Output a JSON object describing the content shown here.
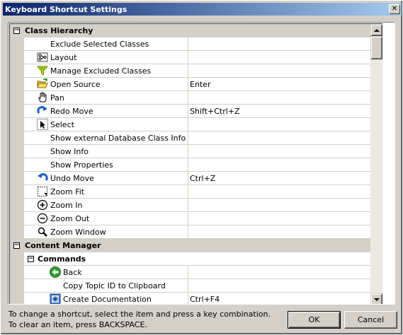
{
  "window": {
    "title": "Keyboard Shortcut Settings",
    "close_glyph": "✕"
  },
  "categories": [
    {
      "label": "Class Hierarchy",
      "expander": "−",
      "items": [
        {
          "label": "Exclude Selected Classes",
          "shortcut": "",
          "icon": ""
        },
        {
          "label": "Layout",
          "shortcut": "",
          "icon": "layout-icon"
        },
        {
          "label": "Manage Excluded Classes",
          "shortcut": "",
          "icon": "filter-icon"
        },
        {
          "label": "Open Source",
          "shortcut": "Enter",
          "icon": "open-folder-icon"
        },
        {
          "label": "Pan",
          "shortcut": "",
          "icon": "hand-icon"
        },
        {
          "label": "Redo Move",
          "shortcut": "Shift+Ctrl+Z",
          "icon": "redo-icon"
        },
        {
          "label": "Select",
          "shortcut": "",
          "icon": "cursor-icon"
        },
        {
          "label": "Show external Database Class Info",
          "shortcut": "",
          "icon": ""
        },
        {
          "label": "Show Info",
          "shortcut": "",
          "icon": ""
        },
        {
          "label": "Show Properties",
          "shortcut": "",
          "icon": ""
        },
        {
          "label": "Undo Move",
          "shortcut": "Ctrl+Z",
          "icon": "undo-icon"
        },
        {
          "label": "Zoom Fit",
          "shortcut": "",
          "icon": "zoom-fit-icon"
        },
        {
          "label": "Zoom In",
          "shortcut": "",
          "icon": "zoom-in-icon"
        },
        {
          "label": "Zoom Out",
          "shortcut": "",
          "icon": "zoom-out-icon"
        },
        {
          "label": "Zoom Window",
          "shortcut": "",
          "icon": "zoom-window-icon"
        }
      ]
    },
    {
      "label": "Content Manager",
      "expander": "−",
      "subcategories": [
        {
          "label": "Commands",
          "expander": "−",
          "items": [
            {
              "label": "Back",
              "shortcut": "",
              "icon": "back-arrow-icon"
            },
            {
              "label": "Copy Topic ID to Clipboard",
              "shortcut": "",
              "icon": ""
            },
            {
              "label": "Create Documentation",
              "shortcut": "Ctrl+F4",
              "icon": "documentation-icon"
            }
          ]
        }
      ]
    }
  ],
  "help_text": "To change a shortcut, select the item and press a key combination. To clear an item, press BACKSPACE.",
  "buttons": {
    "ok": "OK",
    "cancel": "Cancel"
  },
  "colors": {
    "titlebar_start": "#0a246a",
    "titlebar_end": "#a6caf0",
    "dialog_bg": "#d4d0c8"
  }
}
